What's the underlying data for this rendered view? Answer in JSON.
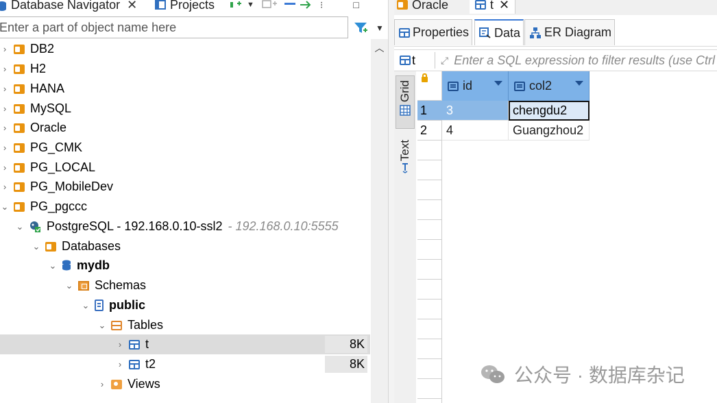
{
  "navigator": {
    "tabs": [
      {
        "label": "Database Navigator"
      },
      {
        "label": "Projects"
      }
    ],
    "search_placeholder": "Enter a part of object name here",
    "tree": [
      {
        "label": "DB2"
      },
      {
        "label": "H2"
      },
      {
        "label": "HANA"
      },
      {
        "label": "MySQL"
      },
      {
        "label": "Oracle"
      },
      {
        "label": "PG_CMK"
      },
      {
        "label": "PG_LOCAL"
      },
      {
        "label": "PG_MobileDev"
      },
      {
        "label": "PG_pgccc"
      },
      {
        "label": "PostgreSQL - 192.168.0.10-ssl2",
        "desc": "- 192.168.0.10:5555"
      },
      {
        "label": "Databases"
      },
      {
        "label": "mydb"
      },
      {
        "label": "Schemas"
      },
      {
        "label": "public"
      },
      {
        "label": "Tables"
      },
      {
        "label": "t",
        "size": "8K"
      },
      {
        "label": "t2",
        "size": "8K"
      },
      {
        "label": "Views"
      }
    ]
  },
  "editor": {
    "tabs": [
      {
        "label": "Oracle"
      },
      {
        "label": "t"
      }
    ],
    "subtabs": [
      {
        "label": "Properties"
      },
      {
        "label": "Data"
      },
      {
        "label": "ER Diagram"
      }
    ],
    "entity": "t",
    "filter_placeholder": "Enter a SQL expression to filter results (use Ctrl+",
    "side_tabs": [
      {
        "label": "Grid"
      },
      {
        "label": "Text"
      }
    ],
    "columns": [
      "id",
      "col2"
    ],
    "rows": [
      {
        "num": "1",
        "id": "3",
        "col2": "chengdu2"
      },
      {
        "num": "2",
        "id": "4",
        "col2": "Guangzhou2"
      }
    ]
  },
  "watermark": {
    "text": "公众号 · 数据库杂记"
  },
  "colors": {
    "selection": "#8bb8e6",
    "header": "#7db2e8",
    "folder": "#e8930f",
    "table_icon": "#2f6fbf"
  }
}
